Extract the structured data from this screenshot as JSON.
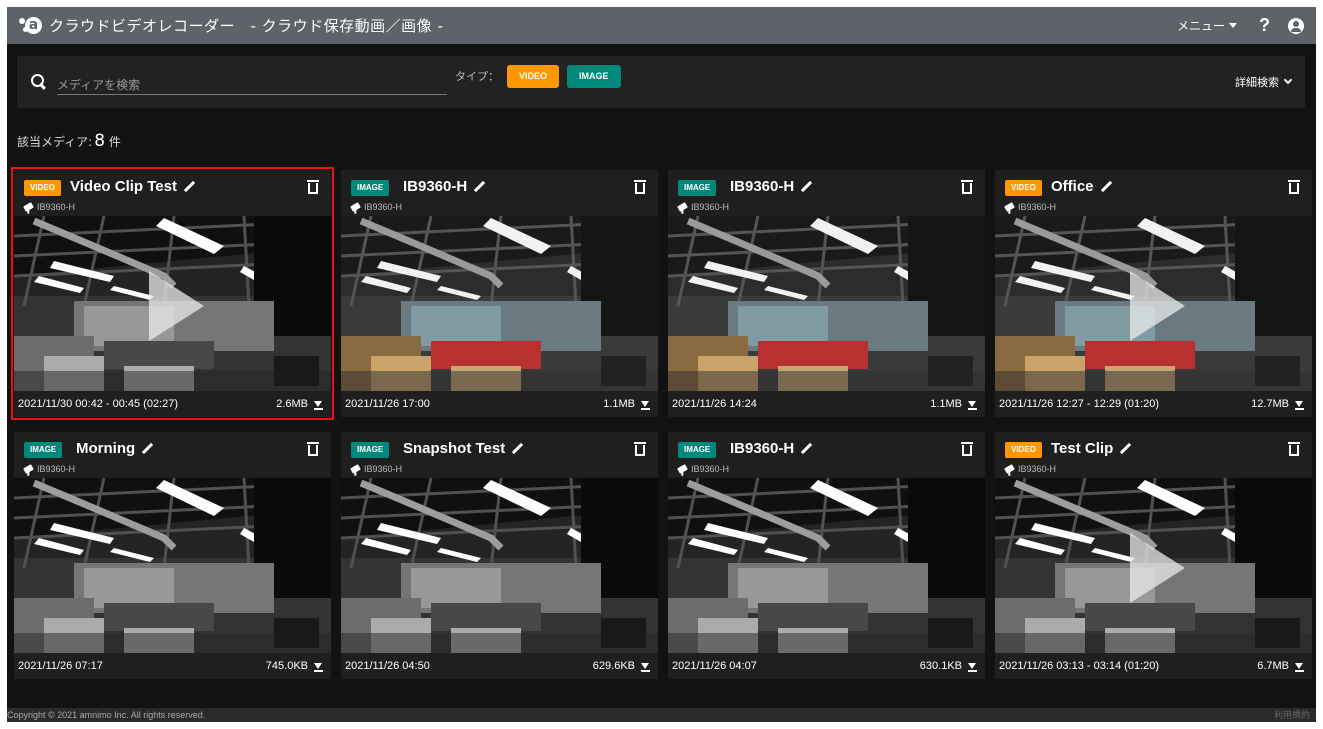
{
  "header": {
    "title": "クラウドビデオレコーダー　- クラウド保存動画／画像 -",
    "menu_label": "メニュー",
    "help_label": "?"
  },
  "search": {
    "placeholder": "メディアを検索",
    "type_label": "タイプ：",
    "chip_video": "VIDEO",
    "chip_image": "IMAGE",
    "advanced_label": "詳細検索"
  },
  "count": {
    "label": "該当メディア:",
    "value": "8",
    "unit": "件"
  },
  "cards": [
    {
      "type": "VIDEO",
      "title": "Video Clip Test",
      "camera": "IB9360-H",
      "datetime": "2021/11/30 00:42 - 00:45 (02:27)",
      "size": "2.6MB",
      "grayscale": true,
      "play": true
    },
    {
      "type": "IMAGE",
      "title": "IB9360-H",
      "camera": "IB9360-H",
      "datetime": "2021/11/26 17:00",
      "size": "1.1MB",
      "grayscale": false,
      "play": false
    },
    {
      "type": "IMAGE",
      "title": "IB9360-H",
      "camera": "IB9360-H",
      "datetime": "2021/11/26 14:24",
      "size": "1.1MB",
      "grayscale": false,
      "play": false
    },
    {
      "type": "VIDEO",
      "title": "Office",
      "camera": "IB9360-H",
      "datetime": "2021/11/26 12:27 - 12:29 (01:20)",
      "size": "12.7MB",
      "grayscale": false,
      "play": true
    },
    {
      "type": "IMAGE",
      "title": "Morning",
      "camera": "IB9360-H",
      "datetime": "2021/11/26 07:17",
      "size": "745.0KB",
      "grayscale": true,
      "play": false
    },
    {
      "type": "IMAGE",
      "title": "Snapshot Test",
      "camera": "IB9360-H",
      "datetime": "2021/11/26 04:50",
      "size": "629.6KB",
      "grayscale": true,
      "play": false
    },
    {
      "type": "IMAGE",
      "title": "IB9360-H",
      "camera": "IB9360-H",
      "datetime": "2021/11/26 04:07",
      "size": "630.1KB",
      "grayscale": true,
      "play": false
    },
    {
      "type": "VIDEO",
      "title": "Test Clip",
      "camera": "IB9360-H",
      "datetime": "2021/11/26 03:13 - 03:14 (01:20)",
      "size": "6.7MB",
      "grayscale": true,
      "play": true
    }
  ],
  "footer": {
    "copyright": "Copyright © 2021 amnimo Inc. All rights reserved.",
    "terms": "利用規約"
  },
  "colors": {
    "video_badge": "#ff9800",
    "image_badge": "#00897b",
    "selection": "#e11111"
  }
}
